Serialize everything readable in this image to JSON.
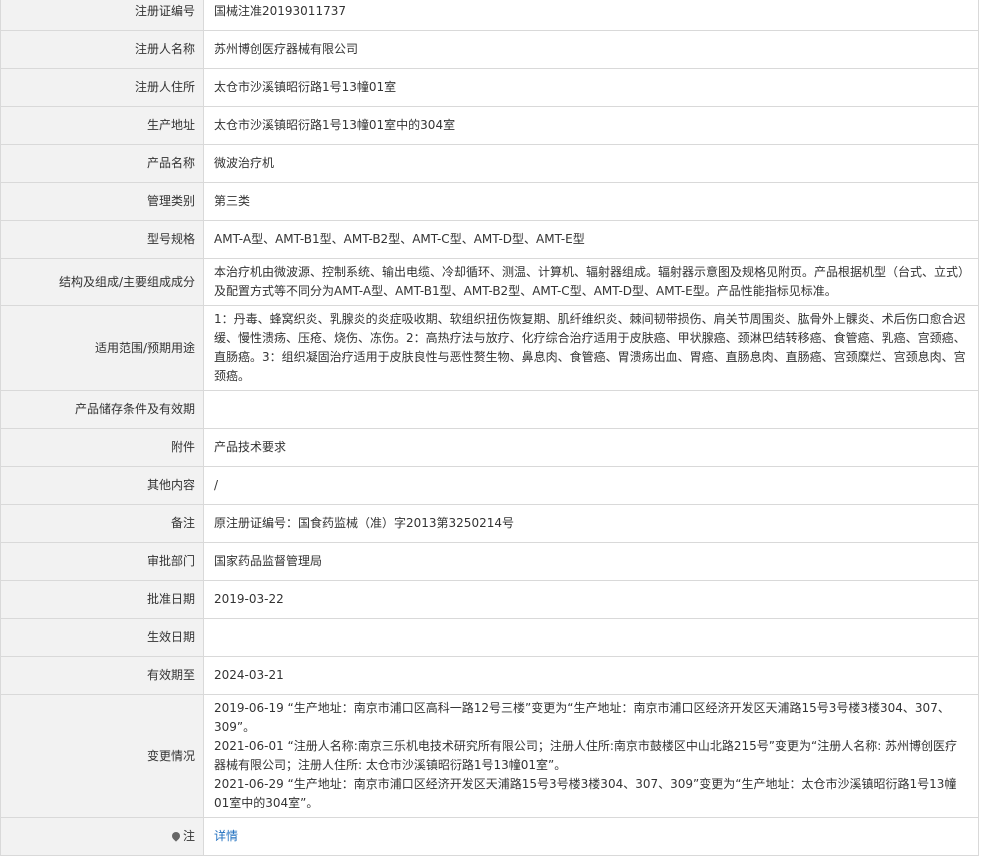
{
  "rows": [
    {
      "label": "注册证编号",
      "value": "国械注准20193011737"
    },
    {
      "label": "注册人名称",
      "value": "苏州博创医疗器械有限公司"
    },
    {
      "label": "注册人住所",
      "value": "太仓市沙溪镇昭衍路1号13幢01室"
    },
    {
      "label": "生产地址",
      "value": "太仓市沙溪镇昭衍路1号13幢01室中的304室"
    },
    {
      "label": "产品名称",
      "value": "微波治疗机"
    },
    {
      "label": "管理类别",
      "value": "第三类"
    },
    {
      "label": "型号规格",
      "value": "AMT-A型、AMT-B1型、AMT-B2型、AMT-C型、AMT-D型、AMT-E型"
    },
    {
      "label": "结构及组成/主要组成成分",
      "value": "本治疗机由微波源、控制系统、输出电缆、冷却循环、测温、计算机、辐射器组成。辐射器示意图及规格见附页。产品根据机型（台式、立式）及配置方式等不同分为AMT-A型、AMT-B1型、AMT-B2型、AMT-C型、AMT-D型、AMT-E型。产品性能指标见标准。"
    },
    {
      "label": "适用范围/预期用途",
      "value": "1：丹毒、蜂窝织炎、乳腺炎的炎症吸收期、软组织扭伤恢复期、肌纤维织炎、棘间韧带损伤、肩关节周围炎、肱骨外上髁炎、术后伤口愈合迟缓、慢性溃疡、压疮、烧伤、冻伤。2：高热疗法与放疗、化疗综合治疗适用于皮肤癌、甲状腺癌、颈淋巴结转移癌、食管癌、乳癌、宫颈癌、直肠癌。3：组织凝固治疗适用于皮肤良性与恶性赘生物、鼻息肉、食管癌、胃溃疡出血、胃癌、直肠息肉、直肠癌、宫颈糜烂、宫颈息肉、宫颈癌。"
    },
    {
      "label": "产品储存条件及有效期",
      "value": ""
    },
    {
      "label": "附件",
      "value": "产品技术要求"
    },
    {
      "label": "其他内容",
      "value": "/"
    },
    {
      "label": "备注",
      "value": "原注册证编号：国食药监械（准）字2013第3250214号"
    },
    {
      "label": "审批部门",
      "value": "国家药品监督管理局"
    },
    {
      "label": "批准日期",
      "value": "2019-03-22"
    },
    {
      "label": "生效日期",
      "value": ""
    },
    {
      "label": "有效期至",
      "value": "2024-03-21"
    }
  ],
  "changes": {
    "label": "变更情况",
    "lines": [
      "2019-06-19 “生产地址：南京市浦口区高科一路12号三楼”变更为“生产地址：南京市浦口区经济开发区天浦路15号3号楼3楼304、307、309”。",
      "2021-06-01 “注册人名称:南京三乐机电技术研究所有限公司；注册人住所:南京市鼓楼区中山北路215号”变更为“注册人名称: 苏州博创医疗器械有限公司；注册人住所: 太仓市沙溪镇昭衍路1号13幢01室”。",
      "2021-06-29 “生产地址：南京市浦口区经济开发区天浦路15号3号楼3楼304、307、309”变更为“生产地址：太仓市沙溪镇昭衍路1号13幢01室中的304室”。"
    ]
  },
  "note": {
    "label": "注",
    "link": "详情",
    "icon": "location-pin-icon"
  }
}
